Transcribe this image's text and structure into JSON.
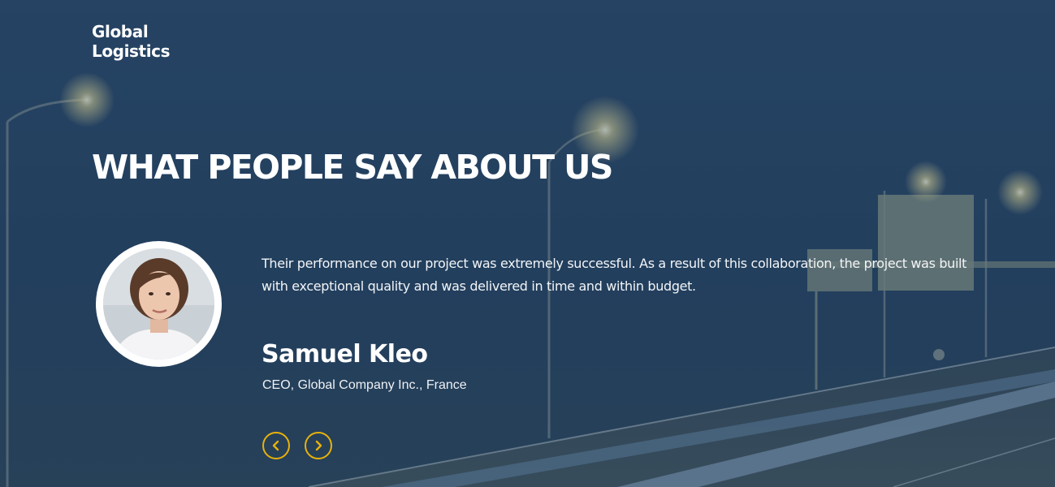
{
  "brand": {
    "line1": "Global",
    "line2": "Logistics"
  },
  "section": {
    "title": "WHAT PEOPLE SAY ABOUT US"
  },
  "testimonial": {
    "quote": "Their performance on our project was extremely successful. As a result of this collaboration, the project was built with exceptional quality and was delivered in time and within budget.",
    "author": "Samuel Kleo",
    "role": "CEO, Global Company Inc., France"
  },
  "navigation": {
    "prev_icon": "chevron-left-icon",
    "next_icon": "chevron-right-icon"
  },
  "colors": {
    "accent": "#e8b10a",
    "overlay": "#25405f",
    "text": "#ffffff"
  }
}
